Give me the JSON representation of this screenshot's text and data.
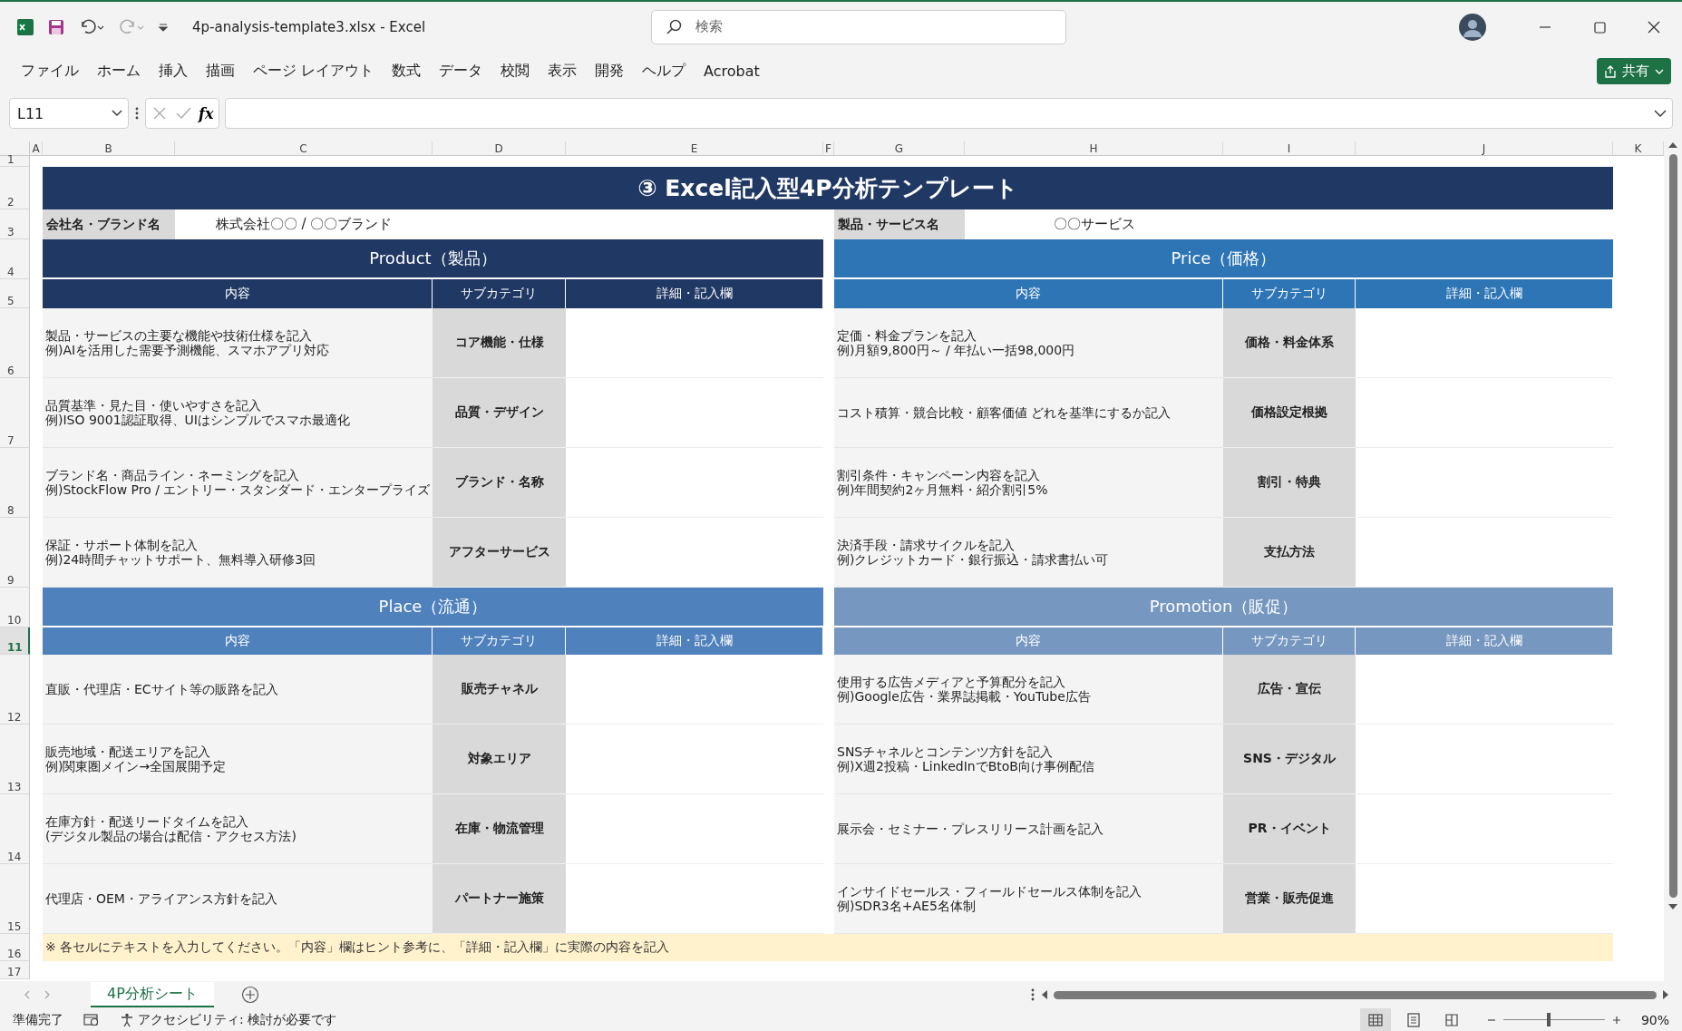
{
  "title_bar": {
    "file_title": "4p-analysis-template3.xlsx  -  Excel",
    "search_placeholder": "検索"
  },
  "menu": [
    "ファイル",
    "ホーム",
    "挿入",
    "描画",
    "ページ レイアウト",
    "数式",
    "データ",
    "校閲",
    "表示",
    "開発",
    "ヘルプ",
    "Acrobat"
  ],
  "share_button": "共有",
  "formula_bar": {
    "name_box": "L11",
    "function_button": "fx"
  },
  "column_headers": [
    "A",
    "B",
    "C",
    "D",
    "E",
    "F",
    "G",
    "H",
    "I",
    "J",
    "K"
  ],
  "row_headers": [
    {
      "label": "1",
      "selected": false
    },
    {
      "label": "2",
      "selected": false
    },
    {
      "label": "3",
      "selected": false
    },
    {
      "label": "4",
      "selected": false
    },
    {
      "label": "5",
      "selected": false
    },
    {
      "label": "6",
      "selected": false
    },
    {
      "label": "7",
      "selected": false
    },
    {
      "label": "8",
      "selected": false
    },
    {
      "label": "9",
      "selected": false
    },
    {
      "label": "10",
      "selected": false
    },
    {
      "label": "11",
      "selected": true
    },
    {
      "label": "12",
      "selected": false
    },
    {
      "label": "13",
      "selected": false
    },
    {
      "label": "14",
      "selected": false
    },
    {
      "label": "15",
      "selected": false
    },
    {
      "label": "16",
      "selected": false
    },
    {
      "label": "17",
      "selected": false
    }
  ],
  "sheet": {
    "title": "③ Excel記入型4P分析テンプレート",
    "info": [
      {
        "label": "会社名・ブランド名",
        "value": "株式会社〇〇 / 〇〇ブランド"
      },
      {
        "label": "製品・サービス名",
        "value": "〇〇サービス"
      }
    ],
    "sections": [
      {
        "title": "Product（製品）",
        "color": "#203864",
        "columns": [
          "内容",
          "サブカテゴリ",
          "詳細・記入欄"
        ],
        "rows": [
          {
            "content": [
              "製品・サービスの主要な機能や技術仕様を記入",
              "例)AIを活用した需要予測機能、スマホアプリ対応"
            ],
            "subcategory": "コア機能・仕様"
          },
          {
            "content": [
              "品質基準・見た目・使いやすさを記入",
              "例)ISO 9001認証取得、UIはシンプルでスマホ最適化"
            ],
            "subcategory": "品質・デザイン"
          },
          {
            "content": [
              "ブランド名・商品ライン・ネーミングを記入",
              "例)StockFlow Pro / エントリー・スタンダード・エンタープライズ"
            ],
            "subcategory": "ブランド・名称"
          },
          {
            "content": [
              "保証・サポート体制を記入",
              "例)24時間チャットサポート、無料導入研修3回"
            ],
            "subcategory": "アフターサービス"
          }
        ]
      },
      {
        "title": "Price（価格）",
        "color": "#2e75b6",
        "columns": [
          "内容",
          "サブカテゴリ",
          "詳細・記入欄"
        ],
        "rows": [
          {
            "content": [
              "定価・料金プランを記入",
              "例)月額9,800円～ / 年払い一括98,000円"
            ],
            "subcategory": "価格・料金体系"
          },
          {
            "content": [
              "コスト積算・競合比較・顧客価値 どれを基準にするか記入"
            ],
            "subcategory": "価格設定根拠"
          },
          {
            "content": [
              "割引条件・キャンペーン内容を記入",
              "例)年間契約2ヶ月無料・紹介割引5%"
            ],
            "subcategory": "割引・特典"
          },
          {
            "content": [
              "決済手段・請求サイクルを記入",
              "例)クレジットカード・銀行振込・請求書払い可"
            ],
            "subcategory": "支払方法"
          }
        ]
      },
      {
        "title": "Place（流通）",
        "color": "#4f81bd",
        "columns": [
          "内容",
          "サブカテゴリ",
          "詳細・記入欄"
        ],
        "rows": [
          {
            "content": [
              "直販・代理店・ECサイト等の販路を記入"
            ],
            "subcategory": "販売チャネル"
          },
          {
            "content": [
              "販売地域・配送エリアを記入",
              "例)関東圏メイン→全国展開予定"
            ],
            "subcategory": "対象エリア"
          },
          {
            "content": [
              "在庫方針・配送リードタイムを記入",
              "(デジタル製品の場合は配信・アクセス方法)"
            ],
            "subcategory": "在庫・物流管理"
          },
          {
            "content": [
              "代理店・OEM・アライアンス方針を記入"
            ],
            "subcategory": "パートナー施策"
          }
        ]
      },
      {
        "title": "Promotion（販促）",
        "color": "#7697c0",
        "columns": [
          "内容",
          "サブカテゴリ",
          "詳細・記入欄"
        ],
        "rows": [
          {
            "content": [
              "使用する広告メディアと予算配分を記入",
              "例)Google広告・業界誌掲載・YouTube広告"
            ],
            "subcategory": "広告・宣伝"
          },
          {
            "content": [
              "SNSチャネルとコンテンツ方針を記入",
              "例)X週2投稿・LinkedInでBtoB向け事例配信"
            ],
            "subcategory": "SNS・デジタル"
          },
          {
            "content": [
              "展示会・セミナー・プレスリリース計画を記入"
            ],
            "subcategory": "PR・イベント"
          },
          {
            "content": [
              "インサイドセールス・フィールドセールス体制を記入",
              "例)SDR3名+AE5名体制"
            ],
            "subcategory": "営業・販売促進"
          }
        ]
      }
    ],
    "note": "※ 各セルにテキストを入力してください。「内容」欄はヒント参考に、「詳細・記入欄」に実際の内容を記入"
  },
  "sheet_tabs": [
    {
      "label": "4P分析シート",
      "selected": true
    }
  ],
  "status_bar": {
    "ready": "準備完了",
    "accessibility": "アクセシビリティ: 検討が必要です",
    "views": [
      {
        "kind": "normal",
        "selected": true
      },
      {
        "kind": "page_layout",
        "selected": false
      },
      {
        "kind": "page_break",
        "selected": false
      }
    ],
    "zoom": {
      "level": 0.45,
      "reading": "90%"
    }
  }
}
